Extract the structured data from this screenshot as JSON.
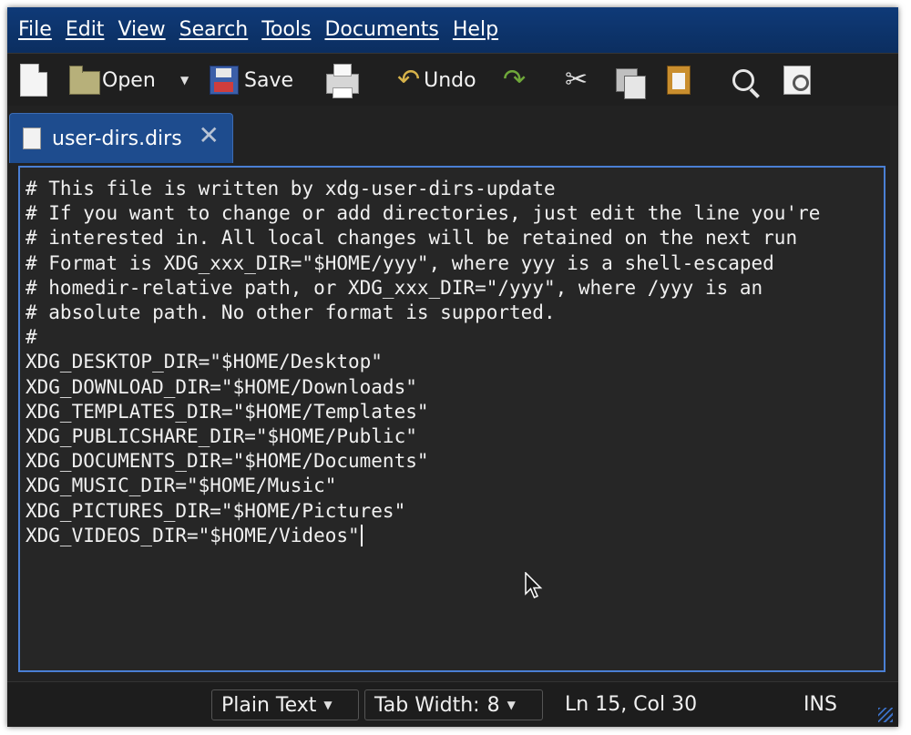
{
  "menubar": {
    "items": [
      "File",
      "Edit",
      "View",
      "Search",
      "Tools",
      "Documents",
      "Help"
    ]
  },
  "toolbar": {
    "new_icon": "new-file-icon",
    "open_label": "Open",
    "save_label": "Save",
    "print_icon": "printer-icon",
    "undo_label": "Undo",
    "redo_icon": "redo-icon",
    "cut_icon": "scissors-icon",
    "copy_icon": "copy-icon",
    "paste_icon": "paste-icon",
    "find_icon": "magnifier-icon",
    "replace_icon": "find-replace-icon"
  },
  "tab": {
    "filename": "user-dirs.dirs",
    "close_glyph": "✕"
  },
  "editor": {
    "lines": [
      "# This file is written by xdg-user-dirs-update",
      "# If you want to change or add directories, just edit the line you're",
      "# interested in. All local changes will be retained on the next run",
      "# Format is XDG_xxx_DIR=\"$HOME/yyy\", where yyy is a shell-escaped",
      "# homedir-relative path, or XDG_xxx_DIR=\"/yyy\", where /yyy is an",
      "# absolute path. No other format is supported.",
      "#",
      "XDG_DESKTOP_DIR=\"$HOME/Desktop\"",
      "XDG_DOWNLOAD_DIR=\"$HOME/Downloads\"",
      "XDG_TEMPLATES_DIR=\"$HOME/Templates\"",
      "XDG_PUBLICSHARE_DIR=\"$HOME/Public\"",
      "XDG_DOCUMENTS_DIR=\"$HOME/Documents\"",
      "XDG_MUSIC_DIR=\"$HOME/Music\"",
      "XDG_PICTURES_DIR=\"$HOME/Pictures\"",
      "XDG_VIDEOS_DIR=\"$HOME/Videos\""
    ]
  },
  "statusbar": {
    "language": "Plain Text",
    "tab_width_label": "Tab Width:",
    "tab_width_value": "8",
    "position": "Ln 15, Col 30",
    "mode": "INS"
  },
  "colors": {
    "menubar": "#0f3a78",
    "tab_active": "#1e4c8e",
    "editor_border": "#4a7fd4",
    "background": "#222222"
  }
}
